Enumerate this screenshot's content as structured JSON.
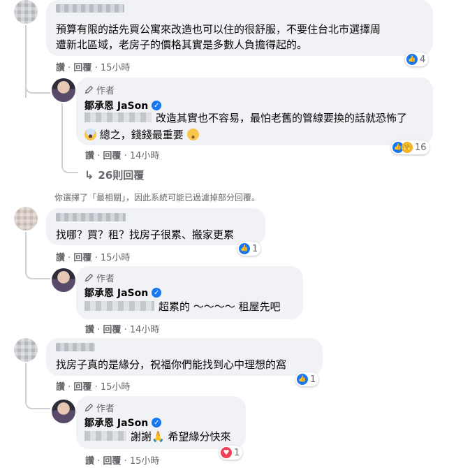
{
  "comments": [
    {
      "text_lines": [
        "預算有限的話先買公寓來改造也可以住的很舒服，不要住台北市選擇周",
        "遭新北區域，老房子的價格其實是多數人負擔得起的。"
      ],
      "actions": {
        "like": "讚",
        "reply": "回覆",
        "time": "15小時"
      },
      "reaction_count": "4"
    },
    {
      "author_badge": "作者",
      "author_name": "鄒承恩 JaSon",
      "text_lines": [
        "改造其實也不容易，最怕老舊的管線要換的話就恐怖了",
        "總之，錢錢最重要"
      ],
      "actions": {
        "like": "讚",
        "reply": "回覆",
        "time": "14小時"
      },
      "reaction_count": "16"
    },
    {
      "text_lines": [
        "找哪？買？租？找房子很累、搬家更累"
      ],
      "actions": {
        "like": "讚",
        "reply": "回覆",
        "time": "15小時"
      },
      "reaction_count": "1"
    },
    {
      "author_badge": "作者",
      "author_name": "鄒承恩 JaSon",
      "text_lines": [
        "超累的 ～～～～ 租屋先吧"
      ],
      "actions": {
        "like": "讚",
        "reply": "回覆",
        "time": "14小時"
      }
    },
    {
      "text_lines": [
        "找房子真的是緣分，祝福你們能找到心中理想的窩"
      ],
      "actions": {
        "like": "讚",
        "reply": "回覆",
        "time": "15小時"
      },
      "reaction_count": "1"
    },
    {
      "author_badge": "作者",
      "author_name": "鄒承恩 JaSon",
      "text_lines": [
        "謝謝",
        "希望緣分快來"
      ],
      "actions": {
        "like": "讚",
        "reply": "回覆",
        "time": "15小時"
      },
      "reaction_count": "1"
    }
  ],
  "view_replies": "26則回覆",
  "filter_notice": "你選擇了「最相關」，因此系統可能已過濾掉部分回覆。",
  "icons": {
    "like": "like-icon",
    "love": "heart-icon",
    "care": "care-icon",
    "pen": "pen-icon",
    "verified": "verified-icon",
    "reply_arrow": "reply-arrow-icon"
  },
  "colors": {
    "accent": "#1877f2",
    "bubble": "#f0f2f5",
    "meta": "#65676b",
    "heart": "#f33e58"
  }
}
